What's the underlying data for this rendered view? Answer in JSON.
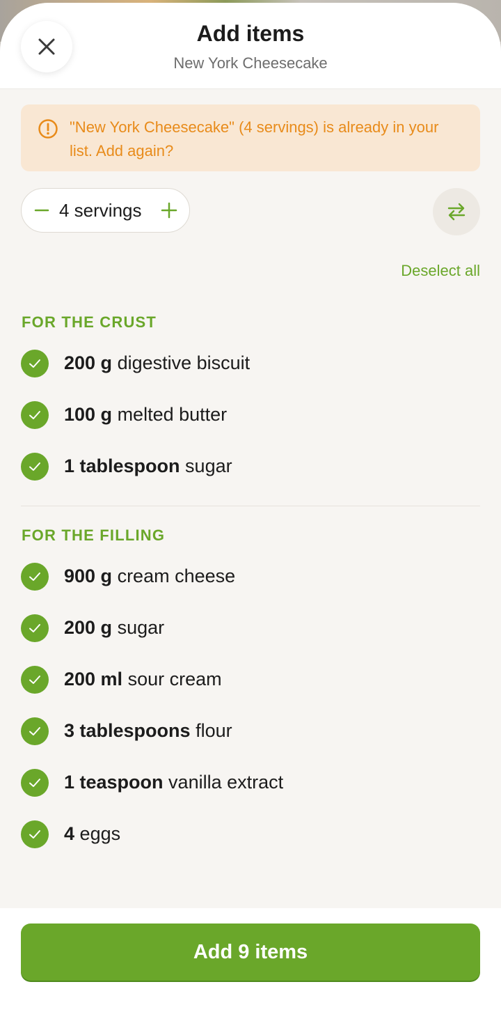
{
  "header": {
    "title": "Add items",
    "subtitle": "New York Cheesecake",
    "close_icon": "close-icon"
  },
  "warning": {
    "icon": "warning-icon",
    "text": "\"New York Cheesecake\" (4 servings) is already in your list. Add again?",
    "color": "#e88b1a",
    "background": "#f9e7d3"
  },
  "servings": {
    "label": "4 servings",
    "minus_icon": "minus-icon",
    "plus_icon": "plus-icon"
  },
  "swap_icon": "swap-arrows-icon",
  "deselect_label": "Deselect all",
  "sections": [
    {
      "title": "FOR THE CRUST",
      "items": [
        {
          "qty": "200 g",
          "name": "digestive biscuit",
          "checked": true
        },
        {
          "qty": "100 g",
          "name": "melted butter",
          "checked": true
        },
        {
          "qty": "1 tablespoon",
          "name": "sugar",
          "checked": true
        }
      ]
    },
    {
      "title": "FOR THE FILLING",
      "items": [
        {
          "qty": "900 g",
          "name": "cream cheese",
          "checked": true
        },
        {
          "qty": "200 g",
          "name": "sugar",
          "checked": true
        },
        {
          "qty": "200 ml",
          "name": "sour cream",
          "checked": true
        },
        {
          "qty": "3 tablespoons",
          "name": "flour",
          "checked": true
        },
        {
          "qty": "1 teaspoon",
          "name": "vanilla extract",
          "checked": true
        },
        {
          "qty": "4",
          "name": "eggs",
          "checked": true
        }
      ]
    }
  ],
  "footer": {
    "add_button_label": "Add 9 items"
  },
  "colors": {
    "accent": "#6aa72a",
    "background": "#f7f5f2"
  }
}
